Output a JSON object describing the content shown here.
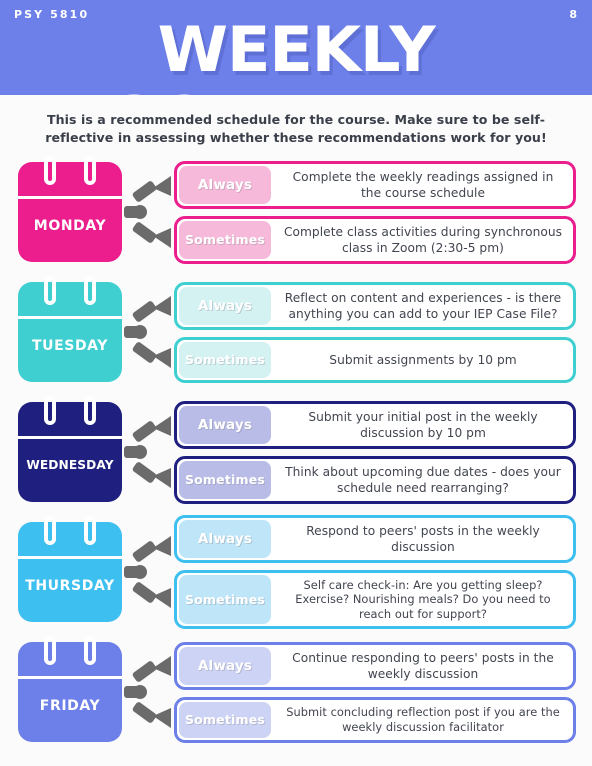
{
  "header": {
    "course_code": "PSY 5810",
    "page_number": "8",
    "title": "WEEKLY SCHEDULE",
    "background_color": "#6d7fe8"
  },
  "intro": {
    "text": "This is a recommended schedule for the course. Make sure to be self-reflective in assessing whether these recommendations work for you!"
  },
  "labels": {
    "always": "Always",
    "sometimes": "Sometimes"
  },
  "days": [
    {
      "name": "MONDAY",
      "color": "#ec1e8e",
      "tag_bg": "#f6b9d9",
      "always_text": "Complete the weekly readings assigned in the course schedule",
      "sometimes_text": "Complete class activities during synchronous class in Zoom (2:30-5 pm)"
    },
    {
      "name": "TUESDAY",
      "color": "#3fcfd0",
      "tag_bg": "#d5f2f3",
      "always_text": "Reflect on content and experiences - is there anything you can add to your IEP Case File?",
      "sometimes_text": "Submit assignments by 10 pm"
    },
    {
      "name": "WEDNESDAY",
      "color": "#1e1f7e",
      "tag_bg": "#b9bce7",
      "always_text": "Submit your initial post in the weekly discussion by 10 pm",
      "sometimes_text": "Think about upcoming due dates - does your schedule need rearranging?"
    },
    {
      "name": "THURSDAY",
      "color": "#3dbfef",
      "tag_bg": "#bee5f8",
      "always_text": "Respond to peers' posts in the weekly discussion",
      "sometimes_text": "Self care check-in: Are you getting sleep? Exercise? Nourishing meals? Do you need to reach out for support?"
    },
    {
      "name": "FRIDAY",
      "color": "#6d7fe8",
      "tag_bg": "#cdd3f4",
      "always_text": "Continue responding to peers' posts in the weekly discussion",
      "sometimes_text": "Submit concluding reflection post if you are the weekly discussion facilitator"
    }
  ],
  "icons": {
    "calendar": "calendar-icon",
    "split_arrow": "split-arrow-icon"
  }
}
